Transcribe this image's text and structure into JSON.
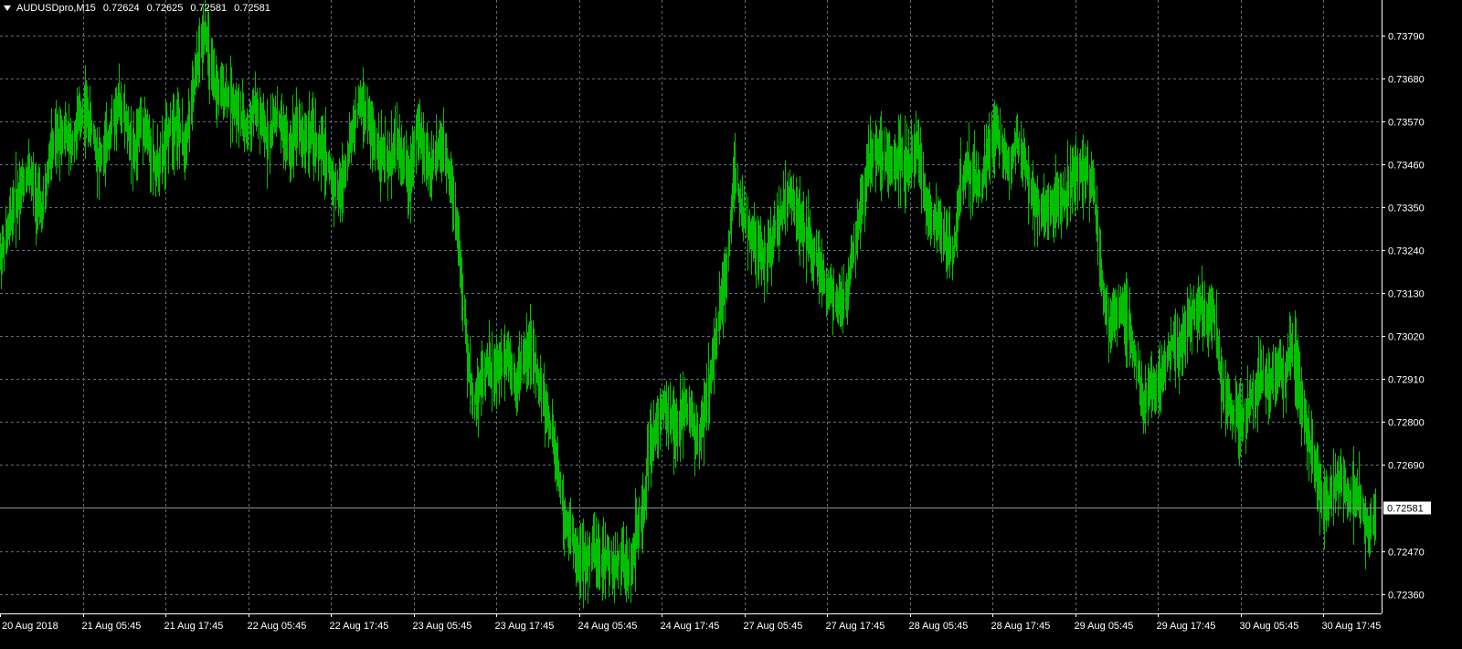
{
  "header": {
    "symbol": "AUDUSDpro,M15",
    "open": "0.72624",
    "high": "0.72625",
    "low": "0.72581",
    "close": "0.72581"
  },
  "colors": {
    "background": "#000000",
    "bars": "#00c000",
    "grid": "#5f6f7f",
    "axis": "#ffffff",
    "text": "#ffffff",
    "price_line": "#8c96a0",
    "price_label_bg": "#ffffff",
    "price_label_text": "#000000"
  },
  "chart_data": {
    "type": "line",
    "xlabel": "",
    "ylabel": "",
    "ylim": [
      0.7231,
      0.7388
    ],
    "grid": true,
    "y_ticks": [
      "0.73790",
      "0.73680",
      "0.73570",
      "0.73460",
      "0.73350",
      "0.73240",
      "0.73130",
      "0.73020",
      "0.72910",
      "0.72800",
      "0.72690",
      "0.72581",
      "0.72470",
      "0.72360"
    ],
    "x_ticks": [
      "20 Aug 2018",
      "21 Aug 05:45",
      "21 Aug 17:45",
      "22 Aug 05:45",
      "22 Aug 17:45",
      "23 Aug 05:45",
      "23 Aug 17:45",
      "24 Aug 05:45",
      "24 Aug 17:45",
      "27 Aug 05:45",
      "27 Aug 17:45",
      "28 Aug 05:45",
      "28 Aug 17:45",
      "29 Aug 05:45",
      "29 Aug 17:45",
      "30 Aug 05:45",
      "30 Aug 17:45"
    ],
    "current_price": 0.72581,
    "current_price_label": "0.72581",
    "series": [
      {
        "values": [
          0.7322,
          0.7328,
          0.7336,
          0.734,
          0.7345,
          0.7338,
          0.7333,
          0.7348,
          0.7352,
          0.7355,
          0.735,
          0.7357,
          0.736,
          0.7355,
          0.7347,
          0.735,
          0.7358,
          0.7362,
          0.7355,
          0.7348,
          0.7358,
          0.7352,
          0.7345,
          0.7348,
          0.7355,
          0.7357,
          0.735,
          0.736,
          0.7372,
          0.7382,
          0.7367,
          0.7364,
          0.7364,
          0.7362,
          0.7358,
          0.7354,
          0.7361,
          0.7356,
          0.7352,
          0.7359,
          0.7355,
          0.7349,
          0.7357,
          0.7352,
          0.7354,
          0.735,
          0.7349,
          0.7342,
          0.7338,
          0.7346,
          0.7355,
          0.7362,
          0.7358,
          0.7352,
          0.7349,
          0.7345,
          0.7352,
          0.7347,
          0.7342,
          0.7355,
          0.735,
          0.7345,
          0.735,
          0.7348,
          0.7342,
          0.7325,
          0.73,
          0.7285,
          0.729,
          0.7295,
          0.7292,
          0.7295,
          0.7298,
          0.729,
          0.7295,
          0.73,
          0.7292,
          0.7286,
          0.7278,
          0.7268,
          0.7255,
          0.725,
          0.7245,
          0.7244,
          0.7247,
          0.7244,
          0.7245,
          0.7242,
          0.7246,
          0.724,
          0.725,
          0.7255,
          0.7275,
          0.7278,
          0.7285,
          0.728,
          0.7278,
          0.7285,
          0.728,
          0.7275,
          0.7285,
          0.7295,
          0.731,
          0.732,
          0.7345,
          0.7335,
          0.7328,
          0.7325,
          0.7322,
          0.7323,
          0.733,
          0.7335,
          0.734,
          0.7332,
          0.7328,
          0.7325,
          0.732,
          0.7315,
          0.7312,
          0.7311,
          0.7312,
          0.7325,
          0.7335,
          0.7345,
          0.735,
          0.7348,
          0.7345,
          0.7348,
          0.7346,
          0.7345,
          0.735,
          0.7338,
          0.7332,
          0.733,
          0.7325,
          0.7322,
          0.734,
          0.7345,
          0.7343,
          0.734,
          0.735,
          0.7355,
          0.735,
          0.7345,
          0.7352,
          0.7348,
          0.734,
          0.7335,
          0.7333,
          0.7335,
          0.7338,
          0.7337,
          0.7343,
          0.7345,
          0.7344,
          0.734,
          0.7318,
          0.7305,
          0.7308,
          0.731,
          0.7303,
          0.7295,
          0.7285,
          0.729,
          0.7288,
          0.7295,
          0.73,
          0.7298,
          0.7305,
          0.7308,
          0.731,
          0.7305,
          0.7308,
          0.729,
          0.7285,
          0.7282,
          0.728,
          0.7285,
          0.7288,
          0.7292,
          0.729,
          0.7295,
          0.7292,
          0.73,
          0.729,
          0.728,
          0.727,
          0.7262,
          0.7258,
          0.7264,
          0.7265,
          0.726,
          0.7262,
          0.7258,
          0.725,
          0.7258
        ]
      }
    ]
  }
}
